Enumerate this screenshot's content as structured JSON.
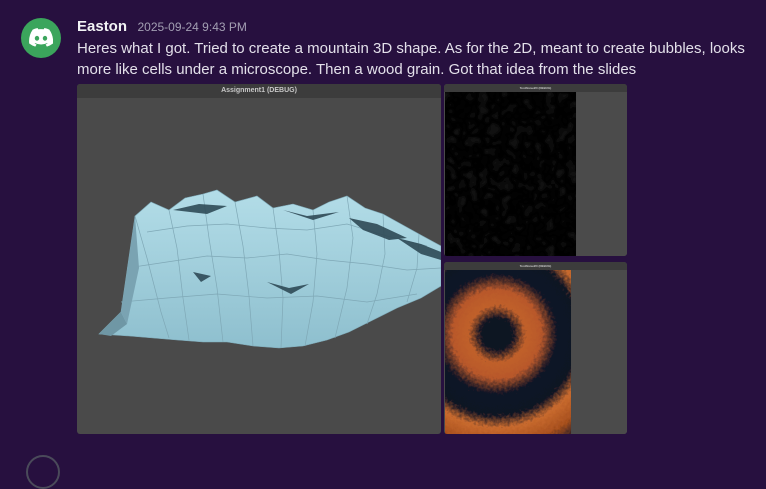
{
  "message": {
    "author": "Easton",
    "timestamp": "2025-09-24 9:43 PM",
    "content": "Heres what I got. Tried to create a mountain 3D shape. As for the 2D, meant to create bubbles, looks more like cells under a microscope. Then a wood grain. Got that idea from the slides"
  },
  "attachments": {
    "mountain": {
      "window_title": "Assignment1 (DEBUG)"
    },
    "bubbles": {
      "window_title": "TestNoise2D (DEBUG)"
    },
    "wood": {
      "window_title": "TestNoise2D (DEBUG)"
    }
  },
  "colors": {
    "background": "#27103f",
    "avatar": "#3ba55c",
    "viewport_bg": "#4a4a4a",
    "mountain": "#a5d2de",
    "wood_orange": "#c0602a",
    "wood_dark": "#0e1224"
  },
  "icons": {
    "avatar": "discord-logo-icon"
  }
}
